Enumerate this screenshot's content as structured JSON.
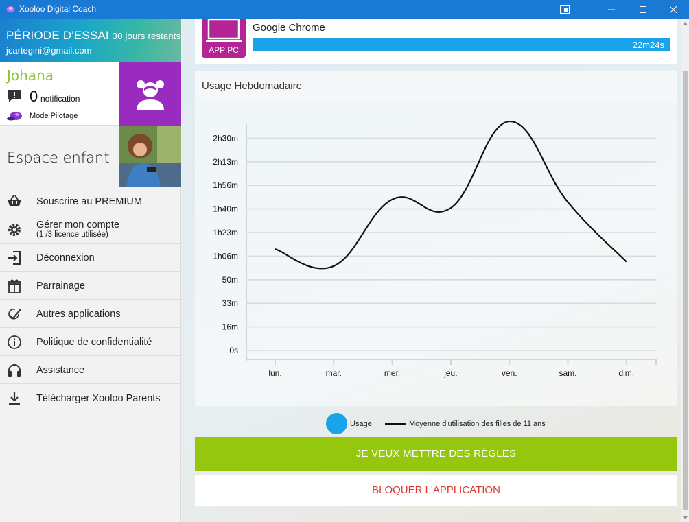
{
  "window": {
    "title": "Xooloo Digital Coach"
  },
  "sidebar": {
    "trial": {
      "label": "PÉRIODE D'ESSAI",
      "days": "30 jours restants",
      "email": "jcartegini@gmail.com"
    },
    "profile": {
      "name": "Johana",
      "notif_count": "0",
      "notif_label": "notification",
      "pilot_label": "Mode Pilotage"
    },
    "espace": {
      "label": "Espace enfant"
    },
    "menu": [
      {
        "label": "Souscrire au PREMIUM"
      },
      {
        "label": "Gérer mon compte",
        "sub": "(1 /3 licence utilisée)"
      },
      {
        "label": "Déconnexion"
      },
      {
        "label": "Parrainage"
      },
      {
        "label": "Autres applications"
      },
      {
        "label": "Politique de confidentialité"
      },
      {
        "label": "Assistance"
      },
      {
        "label": "Télécharger Xooloo Parents"
      }
    ]
  },
  "app": {
    "tile_label": "APP PC",
    "name": "Google Chrome",
    "usage": "22m24s"
  },
  "chart_card": {
    "title": "Usage Hebdomadaire"
  },
  "chart_data": {
    "type": "line",
    "title": "Usage Hebdomadaire",
    "categories": [
      "lun.",
      "mar.",
      "mer.",
      "jeu.",
      "ven.",
      "sam.",
      "dim."
    ],
    "y_ticks": [
      "0s",
      "16m",
      "33m",
      "50m",
      "1h06m",
      "1h23m",
      "1h40m",
      "1h56m",
      "2h13m",
      "2h30m"
    ],
    "ylim_minutes": [
      0,
      166
    ],
    "series": [
      {
        "name": "Moyenne d'utilisation des filles de 11 ans",
        "values_minutes": [
          75,
          63,
          110,
          104,
          165,
          108,
          66
        ]
      },
      {
        "name": "Usage",
        "values_minutes": []
      }
    ],
    "grid": true,
    "legend_position": "bottom"
  },
  "legend": {
    "usage": "Usage",
    "average": "Moyenne d'utilisation des filles de 11 ans"
  },
  "buttons": {
    "rules": "JE VEUX METTRE DES RÈGLES",
    "block": "BLOQUER L'APPLICATION"
  },
  "colors": {
    "titlebar": "#1979d3",
    "accent_green": "#96c70f",
    "usage_blue": "#19a3ea",
    "avatar_purple": "#9a2bbf",
    "app_tile": "#b32594",
    "block_red": "#d9382e"
  }
}
